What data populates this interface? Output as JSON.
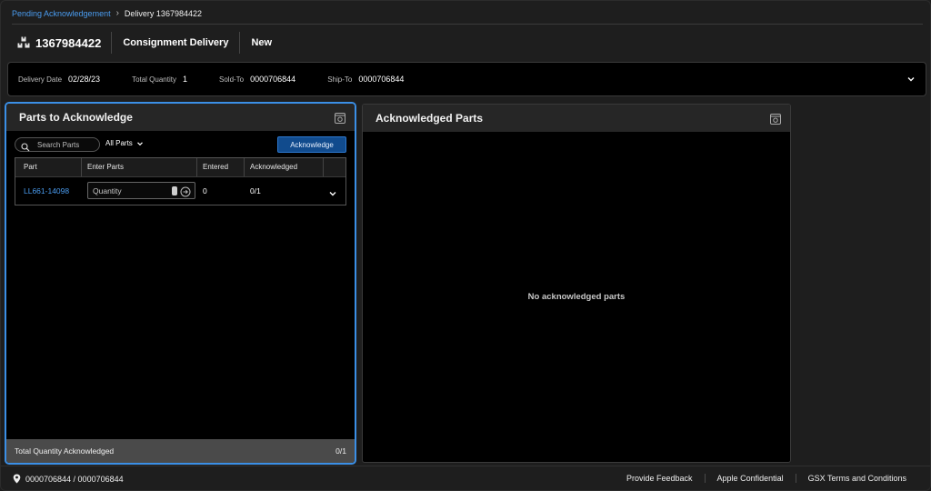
{
  "breadcrumb": {
    "parent": "Pending Acknowledgement",
    "current": "Delivery 1367984422"
  },
  "header": {
    "id": "1367984422",
    "type": "Consignment Delivery",
    "status": "New",
    "icon": "boxes-icon"
  },
  "info": {
    "delivery_date_label": "Delivery Date",
    "delivery_date": "02/28/23",
    "total_quantity_label": "Total Quantity",
    "total_quantity": "1",
    "sold_to_label": "Sold-To",
    "sold_to": "0000706844",
    "ship_to_label": "Ship-To",
    "ship_to": "0000706844"
  },
  "left_panel": {
    "title": "Parts to Acknowledge",
    "search_placeholder": "Search Parts",
    "filter": "All Parts",
    "ack_button": "Acknowledge",
    "columns": [
      "Part",
      "Enter Parts",
      "Entered",
      "Acknowledged"
    ],
    "rows": [
      {
        "part": "LL661-14098",
        "quantity_placeholder": "Quantity",
        "entered": "0",
        "acknowledged": "0/1"
      }
    ],
    "footer_label": "Total Quantity Acknowledged",
    "footer_value": "0/1"
  },
  "right_panel": {
    "title": "Acknowledged Parts",
    "empty_message": "No acknowledged parts"
  },
  "bottom": {
    "location": "0000706844 / 0000706844",
    "links": [
      "Provide Feedback",
      "Apple Confidential",
      "GSX Terms and Conditions"
    ]
  },
  "colors": {
    "accent": "#4a9cf0",
    "button_bg": "#114b8d",
    "focus_border": "#3b8fe6"
  }
}
